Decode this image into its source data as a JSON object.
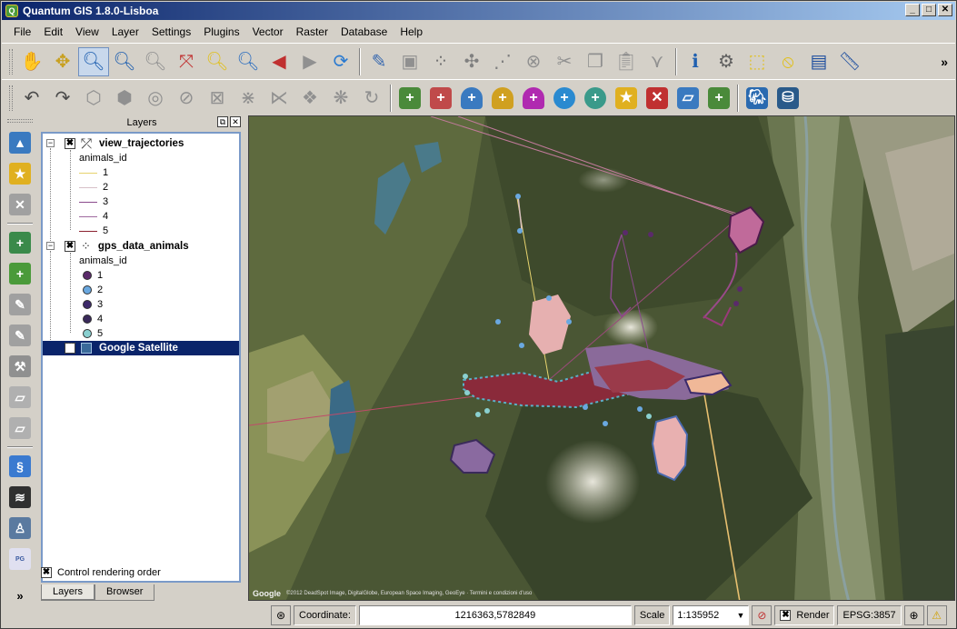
{
  "window": {
    "title": "Quantum GIS 1.8.0-Lisboa"
  },
  "menu": [
    "File",
    "Edit",
    "View",
    "Layer",
    "Settings",
    "Plugins",
    "Vector",
    "Raster",
    "Database",
    "Help"
  ],
  "toolbar1": {
    "buttons": [
      "pan-icon",
      "pan-to-selection-icon",
      "zoom-in-icon",
      "zoom-out-icon",
      "zoom-actual-icon",
      "zoom-full-icon",
      "zoom-selection-icon",
      "zoom-layer-icon",
      "zoom-last-icon",
      "zoom-next-icon",
      "refresh-icon",
      "toggle-editing-icon",
      "save-edits-icon",
      "add-feature-icon",
      "move-feature-icon",
      "node-tool-icon",
      "delete-selected-icon",
      "cut-features-icon",
      "copy-features-icon",
      "paste-features-icon",
      "simplify-icon",
      "identify-icon",
      "action-icon",
      "select-icon",
      "deselect-icon",
      "attribute-table-icon",
      "measure-icon"
    ],
    "more": "»"
  },
  "toolbar2": {
    "buttons": [
      "undo-icon",
      "redo-icon",
      "add-ring-icon",
      "add-part-icon",
      "fill-ring-icon",
      "delete-ring-icon",
      "delete-part-icon",
      "reshape-icon",
      "offset-curve-icon",
      "split-features-icon",
      "split-parts-icon",
      "merge-features-icon",
      "rotate-icon",
      "add-vector-layer-icon",
      "add-raster-layer-icon",
      "add-postgis-layer-icon",
      "add-spatialite-layer-icon",
      "add-mssql-layer-icon",
      "add-wms-layer-icon",
      "add-wcs-layer-icon",
      "add-wfs-layer-icon",
      "remove-layer-icon",
      "new-shapefile-icon",
      "new-spatialite-icon",
      "openlayers-icon",
      "db-manager-icon"
    ]
  },
  "vtoolbar": {
    "buttons": [
      "add-vector-icon",
      "add-raster-icon",
      "remove-icon",
      "wms-icon",
      "wfs-icon",
      "georef-icon",
      "digitize-icon",
      "hammer-icon",
      "vertex-icon",
      "split-icon",
      "dna-icon",
      "layers-stack-icon",
      "person-icon",
      "postgis-icon"
    ],
    "more": "»"
  },
  "layers_panel": {
    "title": "Layers",
    "layers": [
      {
        "name": "view_trajectories",
        "field": "animals_id",
        "classes": [
          {
            "label": "1",
            "color": "#e6d36e"
          },
          {
            "label": "2",
            "color": "#d7c0c8"
          },
          {
            "label": "3",
            "color": "#8a4a8c"
          },
          {
            "label": "4",
            "color": "#a06aa0"
          },
          {
            "label": "5",
            "color": "#8a2030"
          }
        ]
      },
      {
        "name": "gps_data_animals",
        "field": "animals_id",
        "classes": [
          {
            "label": "1",
            "color": "#5a2a6a"
          },
          {
            "label": "2",
            "color": "#6aa8e0"
          },
          {
            "label": "3",
            "color": "#3e2a6a"
          },
          {
            "label": "4",
            "color": "#3a2a5a"
          },
          {
            "label": "5",
            "color": "#8ad0d0"
          }
        ]
      },
      {
        "name": "Google Satellite"
      }
    ],
    "control_rendering_order": "Control rendering order",
    "tabs": [
      "Layers",
      "Browser"
    ]
  },
  "map": {
    "attribution": "©2012 DeadSpot Image, DigitalGlobe, European Space Imaging, GeoEye · Termini e condizioni d'uso",
    "google_logo": "Google"
  },
  "statusbar": {
    "coordinate_label": "Coordinate:",
    "coordinate_value": "1216363,5782849",
    "scale_label": "Scale",
    "scale_value": "1:135952",
    "render_label": "Render",
    "epsg": "EPSG:3857"
  }
}
